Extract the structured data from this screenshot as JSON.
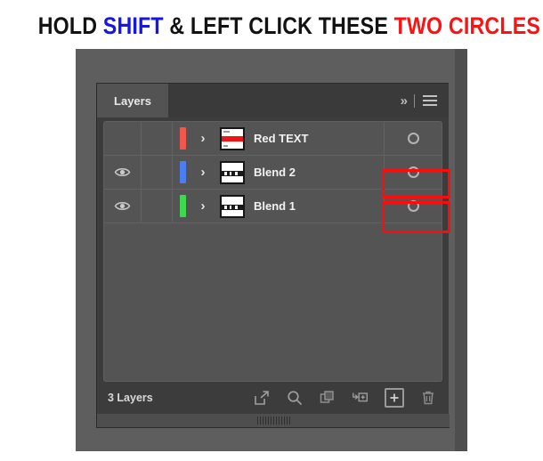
{
  "headline": {
    "segments": [
      {
        "text": "HOLD ",
        "color": "#121212"
      },
      {
        "text": "SHIFT",
        "color": "#1616e8"
      },
      {
        "text": " & LEFT CLICK THESE ",
        "color": "#121212"
      },
      {
        "text": "TWO CIRCLES",
        "color": "#fc1212"
      }
    ],
    "full_text": "HOLD SHIFT & LEFT CLICK THESE TWO CIRCLES"
  },
  "panel": {
    "tab_label": "Layers",
    "collapse_label": "»",
    "menu_icon": "hamburger-menu-icon",
    "collapse_icon": "double-chevron-right-icon"
  },
  "layers": [
    {
      "name": "Red TEXT",
      "visible": false,
      "eye_icon": "eye-icon",
      "color": "#f2574d",
      "expand_icon": "chevron-right-icon",
      "thumbnail": "red-text-thumbnail",
      "thumb_band_color": "#f01414",
      "target_icon": "target-circle-icon",
      "highlighted": false
    },
    {
      "name": "Blend 2",
      "visible": true,
      "eye_icon": "eye-icon",
      "color": "#4b7ef0",
      "expand_icon": "chevron-right-icon",
      "thumbnail": "blend-thumbnail",
      "thumb_band_color": "#1a1a1a",
      "target_icon": "target-circle-icon",
      "highlighted": true
    },
    {
      "name": "Blend 1",
      "visible": true,
      "eye_icon": "eye-icon",
      "color": "#3ed94e",
      "expand_icon": "chevron-right-icon",
      "thumbnail": "blend-thumbnail",
      "thumb_band_color": "#1a1a1a",
      "target_icon": "target-circle-icon",
      "highlighted": true
    }
  ],
  "footer": {
    "count_label": "3 Layers",
    "icons": [
      {
        "name": "release-to-layers-icon",
        "title": "Release to Layers"
      },
      {
        "name": "locate-object-icon",
        "title": "Locate Object"
      },
      {
        "name": "duplicate-layer-icon",
        "title": "Make/Release Clipping Mask"
      },
      {
        "name": "create-sublayer-icon",
        "title": "Create New Sublayer"
      },
      {
        "name": "new-layer-icon",
        "title": "Create New Layer"
      },
      {
        "name": "delete-layer-icon",
        "title": "Delete Selection"
      }
    ]
  },
  "annotations": {
    "highlight_color": "#fb0d0d",
    "boxes": [
      {
        "target": "Blend 2",
        "label": "target-circle-highlight"
      },
      {
        "target": "Blend 1",
        "label": "target-circle-highlight"
      }
    ]
  }
}
